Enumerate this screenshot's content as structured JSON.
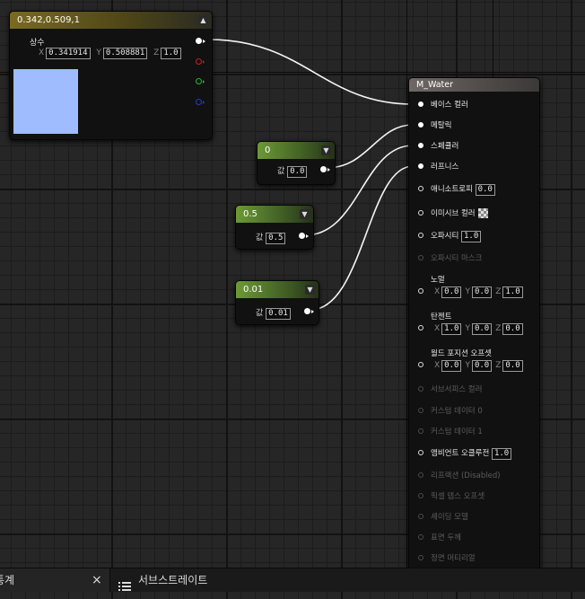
{
  "constant_node": {
    "title": "0.342,0.509,1",
    "output_label": "상수",
    "x_label": "X",
    "x_value": "0.341914",
    "y_label": "Y",
    "y_value": "0.508881",
    "z_label": "Z",
    "z_value": "1.0",
    "swatch_color": "#9ebcff"
  },
  "scalar_nodes": [
    {
      "title": "0",
      "value_label": "값",
      "value": "0.0"
    },
    {
      "title": "0.5",
      "value_label": "값",
      "value": "0.5"
    },
    {
      "title": "0.01",
      "value_label": "값",
      "value": "0.01"
    }
  ],
  "material_node": {
    "title": "M_Water",
    "pins": {
      "base_color": "베이스 컬러",
      "metallic": "메탈릭",
      "specular": "스페큘러",
      "roughness": "러프니스",
      "anisotropy": "애니소트로피",
      "anisotropy_value": "0.0",
      "emissive": "이미시브 컬러",
      "opacity": "오파시티",
      "opacity_value": "1.0",
      "opacity_mask": "오파시티 마스크",
      "normal": "노멀",
      "normal_x": "0.0",
      "normal_y": "0.0",
      "normal_z": "1.0",
      "tangent": "탄젠트",
      "tangent_x": "1.0",
      "tangent_y": "0.0",
      "tangent_z": "0.0",
      "wpo": "월드 포지션 오프셋",
      "wpo_x": "0.0",
      "wpo_y": "0.0",
      "wpo_z": "0.0",
      "subsurface": "서브서피스 컬러",
      "custom0": "커스텀 데이터 0",
      "custom1": "커스텀 데이터 1",
      "ao": "앰비언트 오클루전",
      "ao_value": "1.0",
      "refraction": "리프랙션 (Disabled)",
      "pdo": "픽셀 뎁스 오프셋",
      "shading_model": "셰이딩 모델",
      "surface_thickness": "표면 두께",
      "front_material": "정면 머티리얼"
    },
    "axis": {
      "x": "X",
      "y": "Y",
      "z": "Z"
    }
  },
  "bottom_tabs": {
    "stats_label": "통계",
    "close_glyph": "×",
    "substrate_label": "서브스트레이트"
  },
  "colors": {
    "constant_header": "#7a6a20",
    "scalar_header": "#6c9a35",
    "material_header": "#6f6866"
  }
}
